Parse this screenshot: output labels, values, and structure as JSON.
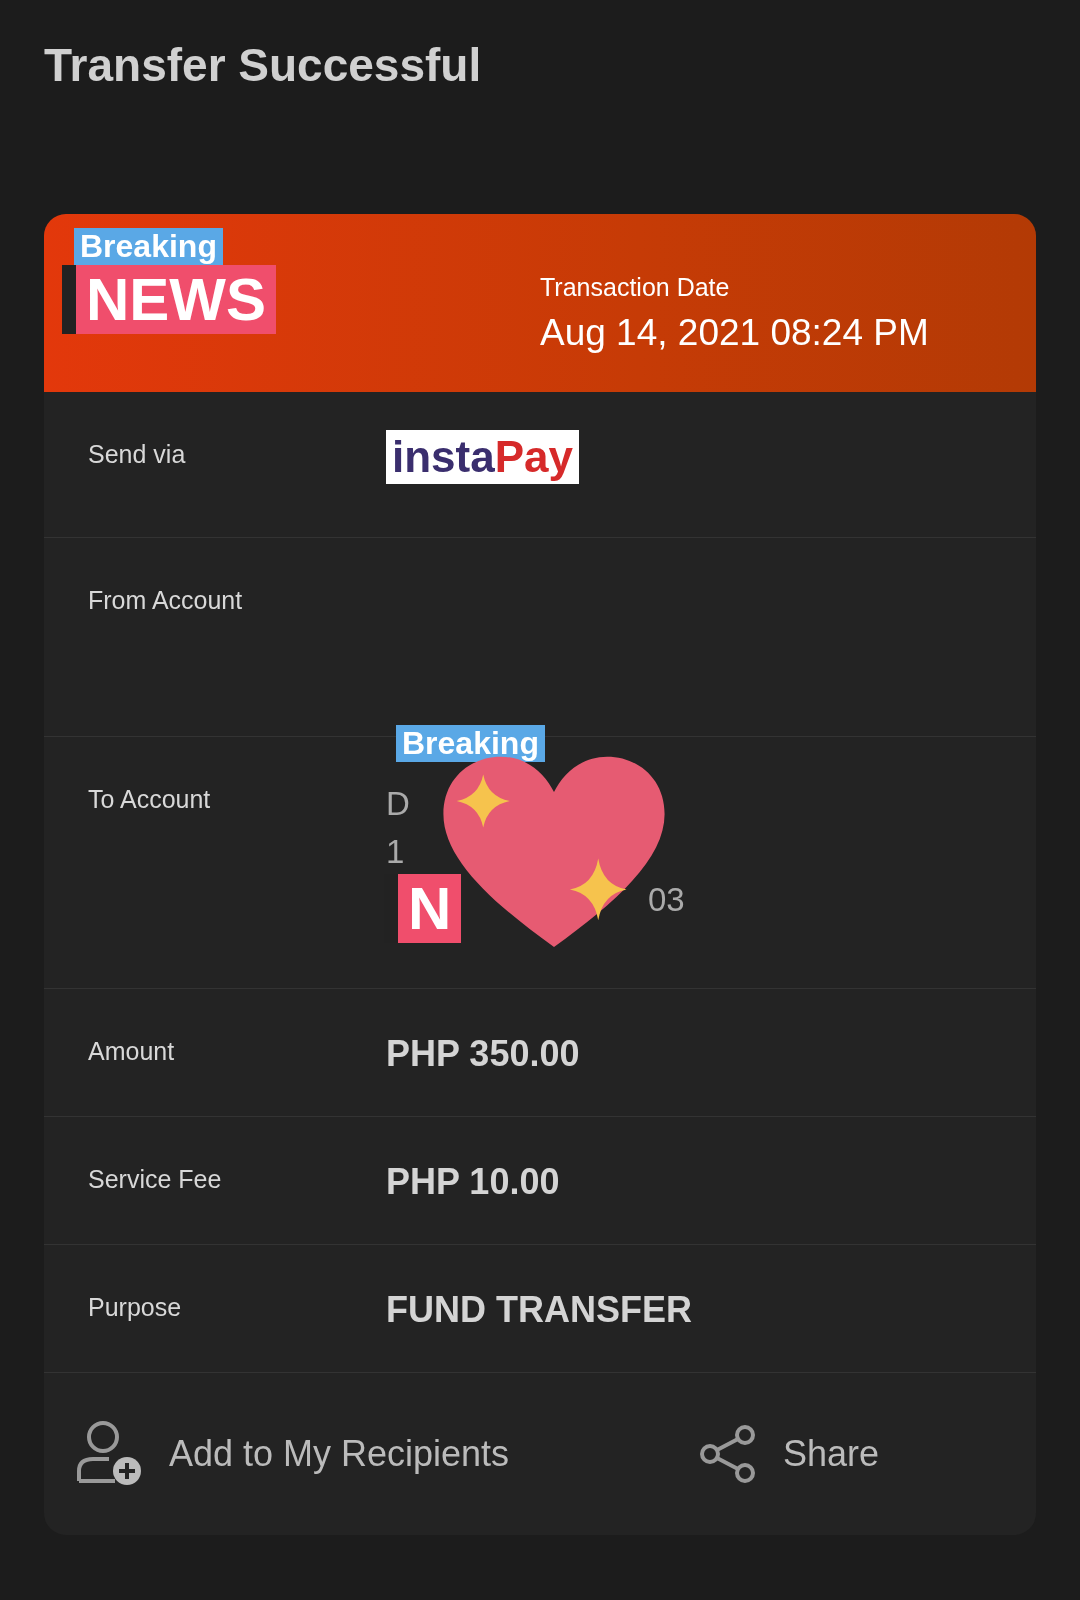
{
  "title": "Transfer Successful",
  "header": {
    "transaction_date_label": "Transaction Date",
    "transaction_date": "Aug 14, 2021 08:24 PM",
    "sticker": {
      "top": "Breaking",
      "bottom": "NEWS"
    }
  },
  "rows": [
    {
      "kind": "logo",
      "label": "Send via",
      "logo": [
        "insta",
        "Pay"
      ]
    },
    {
      "kind": "lines",
      "label": "From Account",
      "lines": []
    },
    {
      "kind": "covered",
      "label": "To Account",
      "lines": [
        "D",
        "1",
        "03"
      ],
      "sticker": {
        "top": "Breaking",
        "bottom": "N"
      }
    },
    {
      "kind": "value",
      "label": "Amount",
      "value": "PHP 350.00"
    },
    {
      "kind": "value",
      "label": "Service Fee",
      "value": "PHP 10.00"
    },
    {
      "kind": "value",
      "label": "Purpose",
      "value": "FUND TRANSFER"
    }
  ],
  "actions": [
    {
      "kind": "add-recipient",
      "label": "Add to My Recipients"
    },
    {
      "kind": "share",
      "label": "Share"
    }
  ]
}
